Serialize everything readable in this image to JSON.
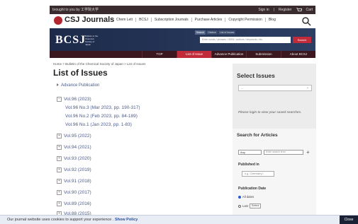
{
  "top_strip": {
    "brought_by": "brought to you by 工学院大学",
    "sign_in": "Sign in",
    "register": "Register",
    "cart": "Cart"
  },
  "nav": {
    "logo": "CSJ Journals",
    "links": [
      "Chem Lett",
      "BCSJ",
      "Subscription Journals",
      "Purchase Articles",
      "Copyright Permission",
      "Blog"
    ]
  },
  "banner": {
    "logo": "BCSJ",
    "subtitle": "Bulletin of the Chemical Society of Japan",
    "search_tabs": [
      "Search",
      "Citation",
      "List of Issues"
    ],
    "search_placeholder": "Enter words / phrases / ISBN / authors / keywords / etc.",
    "search_button": "Search"
  },
  "tabs": [
    "TOP",
    "List of Issue",
    "Advance Publication",
    "Submission",
    "About BCSJ"
  ],
  "active_tab": "List of Issue",
  "breadcrumb": "Home > Bulletin of the Chemical Society of Japan > List of Issues",
  "page_title": "List of Issues",
  "list": {
    "advance": "Advance Publication",
    "expanded_volume": "Vol.96 (2023)",
    "issues": [
      "Vol.96 No.3 (Mar 2023, pp. 190-317)",
      "Vol.96 No.2 (Feb 2023, pp. 84-189)",
      "Vol.96 No.1 (Jan 2023, pp. 1-83)"
    ],
    "volumes": [
      "Vol.95 (2022)",
      "Vol.94 (2021)",
      "Vol.93 (2020)",
      "Vol.92 (2019)",
      "Vol.91 (2018)",
      "Vol.90 (2017)",
      "Vol.89 (2016)",
      "Vol.88 (2015)"
    ]
  },
  "sidebar": {
    "select_issues_title": "Select Issues",
    "select_placeholder": "--",
    "login_note": "Please login to view your saved searches.",
    "search_title": "Search for Articles",
    "any_option": "Any",
    "term_placeholder": "Enter search term",
    "published_in": "Published in",
    "published_placeholder": "e.g. Chemistry l",
    "pub_date_title": "Publication Date",
    "all_dates": "All dates",
    "last_label": "Last",
    "last_select": "Select"
  },
  "cookie": {
    "text": "Our journal website uses cookies to support your experience .",
    "policy": "Show Policy",
    "close": "Close"
  }
}
